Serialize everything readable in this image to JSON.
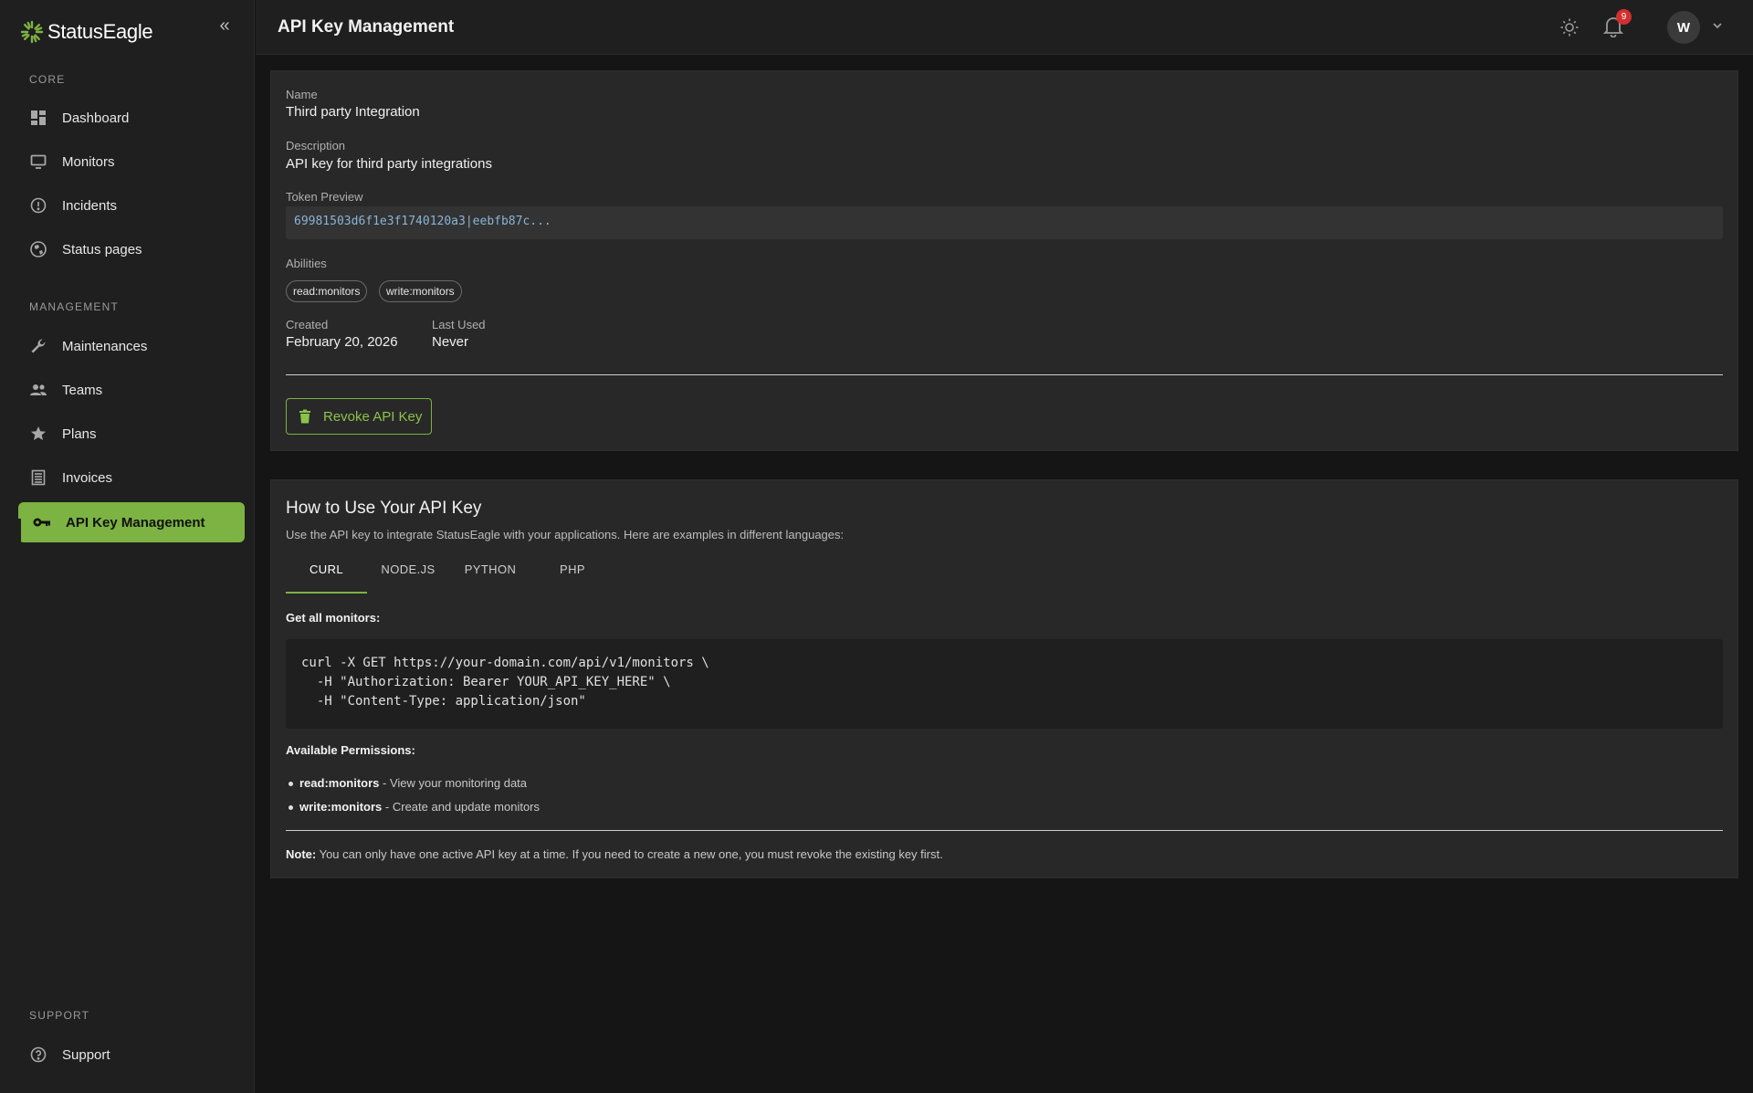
{
  "app": {
    "name": "StatusEagle"
  },
  "sidebar": {
    "sections": {
      "core": "CORE",
      "management": "MANAGEMENT",
      "support": "SUPPORT"
    },
    "items": [
      {
        "label": "Dashboard",
        "icon": "dashboard-icon"
      },
      {
        "label": "Monitors",
        "icon": "monitor-icon"
      },
      {
        "label": "Incidents",
        "icon": "alert-circle-icon"
      },
      {
        "label": "Status pages",
        "icon": "globe-icon"
      },
      {
        "label": "Maintenances",
        "icon": "wrench-icon"
      },
      {
        "label": "Teams",
        "icon": "people-icon"
      },
      {
        "label": "Plans",
        "icon": "star-icon"
      },
      {
        "label": "Invoices",
        "icon": "receipt-icon"
      },
      {
        "label": "API Key Management",
        "icon": "key-icon",
        "active": true
      },
      {
        "label": "Support",
        "icon": "help-circle-icon"
      }
    ]
  },
  "header": {
    "title": "API Key Management",
    "notification_count": "9",
    "avatar_initial": "W"
  },
  "key_card": {
    "name_label": "Name",
    "name_value": "Third party Integration",
    "description_label": "Description",
    "description_value": "API key for third party integrations",
    "token_label": "Token Preview",
    "token_value": "69981503d6f1e3f1740120a3|eebfb87c...",
    "abilities_label": "Abilities",
    "abilities": [
      "read:monitors",
      "write:monitors"
    ],
    "created_label": "Created",
    "created_value": "February 20, 2026",
    "last_used_label": "Last Used",
    "last_used_value": "Never",
    "revoke_label": "Revoke API Key"
  },
  "usage_card": {
    "title": "How to Use Your API Key",
    "subtitle": "Use the API key to integrate StatusEagle with your applications. Here are examples in different languages:",
    "tabs": [
      "CURL",
      "NODE.JS",
      "PYTHON",
      "PHP"
    ],
    "active_tab": "CURL",
    "example_heading": "Get all monitors:",
    "code_lines": [
      "curl -X GET https://your-domain.com/api/v1/monitors \\",
      "  -H \"Authorization: Bearer YOUR_API_KEY_HERE\" \\",
      "  -H \"Content-Type: application/json\""
    ],
    "permissions_heading": "Available Permissions:",
    "permissions": [
      {
        "name": "read:monitors",
        "desc": " - View your monitoring data"
      },
      {
        "name": "write:monitors",
        "desc": " - Create and update monitors"
      }
    ],
    "note_label": "Note:",
    "note_text": " You can only have one active API key at a time. If you need to create a new one, you must revoke the existing key first."
  },
  "colors": {
    "accent": "#7cb342",
    "sidebar_bg": "#1f1f1f",
    "page_bg": "#151515",
    "card_bg": "#282828",
    "badge": "#d32f2f"
  }
}
